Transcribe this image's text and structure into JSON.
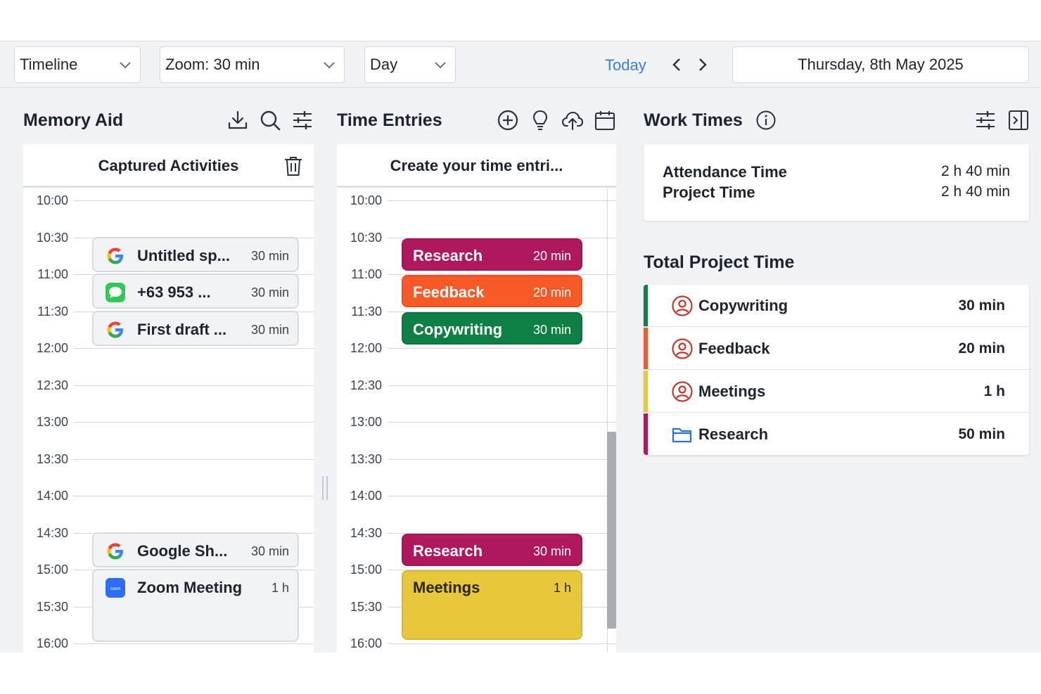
{
  "toolbar": {
    "view_select": "Timeline",
    "zoom_select": "Zoom: 30 min",
    "period_select": "Day",
    "today_label": "Today",
    "current_date": "Thursday, 8th May 2025"
  },
  "memory_aid": {
    "title": "Memory Aid",
    "column_header": "Captured Activities",
    "time_labels": [
      "10:00",
      "10:30",
      "11:00",
      "11:30",
      "12:00",
      "12:30",
      "13:00",
      "13:30",
      "14:00",
      "14:30",
      "15:00",
      "15:30",
      "16:00"
    ],
    "activities": [
      {
        "app_icon": "google-icon",
        "title": "Untitled sp...",
        "duration": "30 min"
      },
      {
        "app_icon": "messages-icon",
        "title": "+63 953 ...",
        "duration": "30 min"
      },
      {
        "app_icon": "google-icon",
        "title": "First draft ...",
        "duration": "30 min"
      },
      {
        "app_icon": "google-icon",
        "title": "Google Sh...",
        "duration": "30 min"
      },
      {
        "app_icon": "zoom-icon",
        "title": "Zoom Meeting",
        "duration": "1 h"
      }
    ]
  },
  "time_entries": {
    "title": "Time Entries",
    "column_header": "Create your time entri...",
    "time_labels": [
      "10:00",
      "10:30",
      "11:00",
      "11:30",
      "12:00",
      "12:30",
      "13:00",
      "13:30",
      "14:00",
      "14:30",
      "15:00",
      "15:30",
      "16:00"
    ],
    "entries": [
      {
        "project": "Research",
        "duration": "20 min",
        "color": "#b0185d"
      },
      {
        "project": "Feedback",
        "duration": "20 min",
        "color": "#f75a27"
      },
      {
        "project": "Copywriting",
        "duration": "30 min",
        "color": "#0e7f45"
      },
      {
        "project": "Research",
        "duration": "30 min",
        "color": "#b0185d"
      },
      {
        "project": "Meetings",
        "duration": "1 h",
        "color": "#e6c83a"
      }
    ]
  },
  "work_times": {
    "title": "Work Times",
    "attendance_label": "Attendance Time",
    "attendance_value": "2 h 40 min",
    "project_label": "Project Time",
    "project_value": "2 h 40 min"
  },
  "total_project_time": {
    "title": "Total Project Time",
    "projects": [
      {
        "name": "Copywriting",
        "duration": "30 min",
        "color": "#0e7f45",
        "icon": "person-circle-icon"
      },
      {
        "name": "Feedback",
        "duration": "20 min",
        "color": "#f75a27",
        "icon": "person-circle-icon"
      },
      {
        "name": "Meetings",
        "duration": "1 h",
        "color": "#e6c83a",
        "icon": "person-circle-icon"
      },
      {
        "name": "Research",
        "duration": "50 min",
        "color": "#b0185d",
        "icon": "folder-icon"
      }
    ]
  }
}
